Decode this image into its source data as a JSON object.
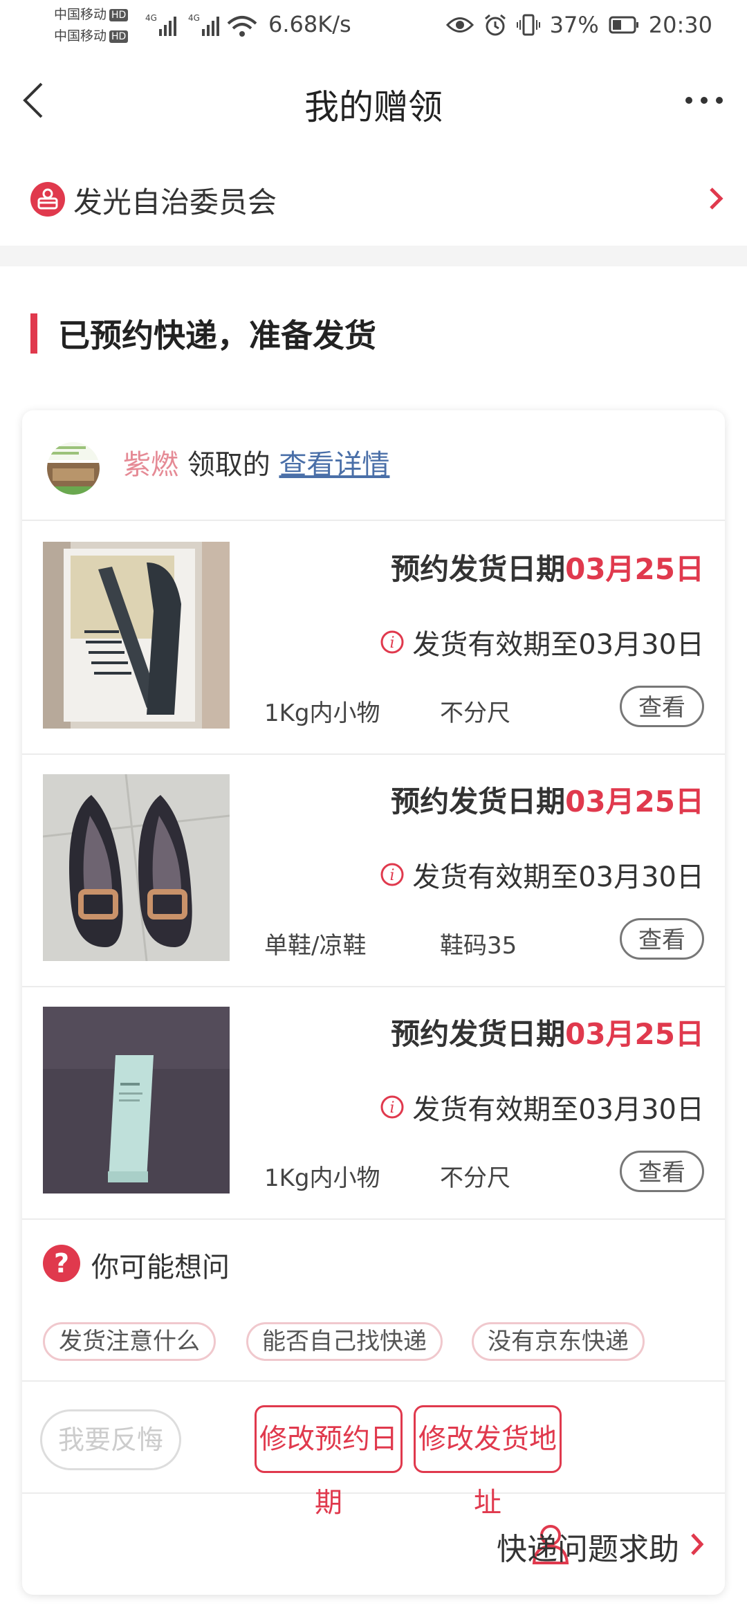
{
  "status_bar": {
    "carrier_1": "中国移动",
    "carrier_2": "中国移动",
    "hd_label": "HD",
    "network": "4G",
    "net_speed": "6.68K/s",
    "battery": "37%",
    "time": "20:30"
  },
  "header": {
    "title": "我的赠领"
  },
  "shop": {
    "name": "发光自治委员会"
  },
  "section": {
    "title": "已预约快递，准备发货"
  },
  "card": {
    "claimer": "紫燃",
    "claimed_text": "领取的",
    "detail_link": "查看详情",
    "items": [
      {
        "date_label": "预约发货日期",
        "date_value": "03月25日",
        "valid_text": "发货有效期至03月30日",
        "tag1": "1Kg内小物",
        "tag2": "不分尺",
        "view_label": "查看"
      },
      {
        "date_label": "预约发货日期",
        "date_value": "03月25日",
        "valid_text": "发货有效期至03月30日",
        "tag1": "单鞋/凉鞋",
        "tag2": "鞋码35",
        "view_label": "查看"
      },
      {
        "date_label": "预约发货日期",
        "date_value": "03月25日",
        "valid_text": "发货有效期至03月30日",
        "tag1": "1Kg内小物",
        "tag2": "不分尺",
        "view_label": "查看"
      }
    ],
    "faq": {
      "title": "你可能想问",
      "chips": [
        "发货注意什么",
        "能否自己找快递",
        "没有京东快递"
      ]
    },
    "actions": {
      "regret": "我要反悔",
      "modify_date": "修改预约日期",
      "modify_address": "修改发货地址"
    },
    "help": {
      "label": "快递问题求助"
    }
  },
  "colors": {
    "accent": "#e0394d",
    "link": "#4a6fa8",
    "claimer_name": "#e58a95"
  }
}
